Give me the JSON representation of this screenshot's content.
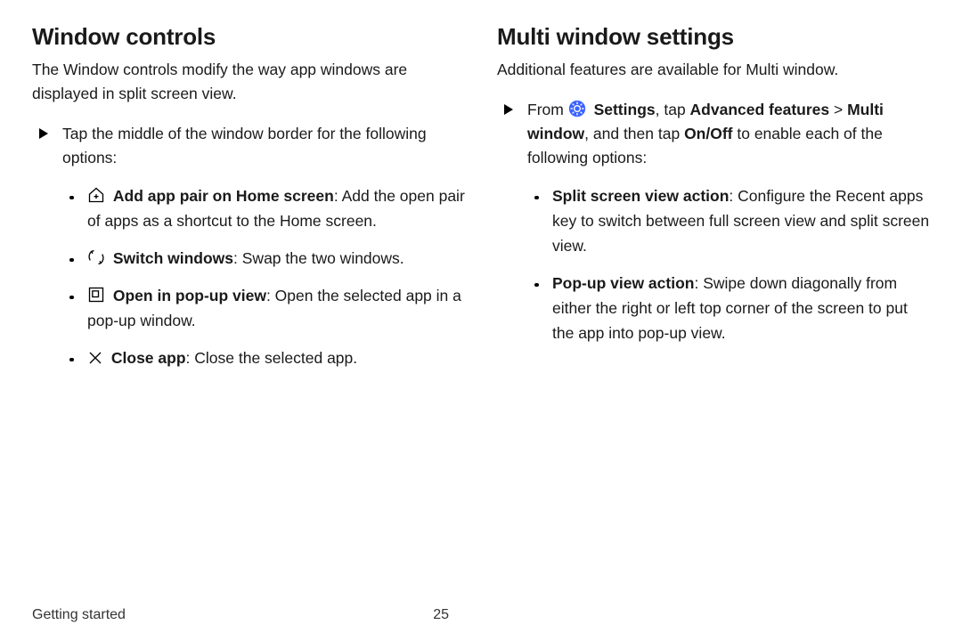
{
  "left": {
    "heading": "Window controls",
    "intro": "The Window controls modify the way app windows are displayed in split screen view.",
    "step_text": "Tap the middle of the window border for the following options:",
    "items": [
      {
        "bold": "Add app pair on Home screen",
        "rest": ": Add the open pair of apps as a shortcut to the Home screen."
      },
      {
        "bold": "Switch windows",
        "rest": ": Swap the two windows."
      },
      {
        "bold": "Open in pop-up view",
        "rest": ": Open the selected app in a pop-up window."
      },
      {
        "bold": "Close app",
        "rest": ": Close the selected app."
      }
    ]
  },
  "right": {
    "heading": "Multi window settings",
    "intro": "Additional features are available for Multi window.",
    "step_pre": "From ",
    "step_settings": "Settings",
    "step_mid1": ", tap ",
    "step_advanced": "Advanced features",
    "step_gt": " > ",
    "step_mw": "Multi window",
    "step_mid2": ", and then tap ",
    "step_onoff": "On/Off",
    "step_post": " to enable each of the following options:",
    "items": [
      {
        "bold": "Split screen view action",
        "rest": ": Configure the Recent apps key to switch between full screen view and split screen view."
      },
      {
        "bold": "Pop-up view action",
        "rest": ": Swipe down diagonally from either the right or left top corner of the screen to put the app into pop-up view."
      }
    ]
  },
  "footer": {
    "section": "Getting started",
    "page": "25"
  }
}
